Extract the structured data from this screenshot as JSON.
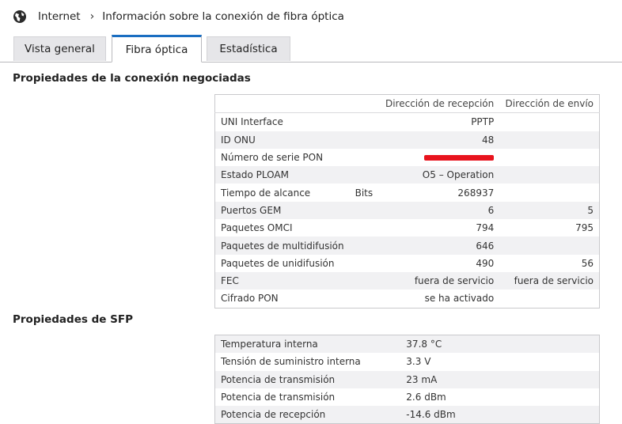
{
  "breadcrumb": {
    "root": "Internet",
    "current": "Información sobre la conexión de fibra óptica"
  },
  "tabs": [
    "Vista general",
    "Fibra óptica",
    "Estadística"
  ],
  "negotiated": {
    "title": "Propiedades de la conexión negociadas",
    "headers": {
      "rx": "Dirección de recepción",
      "tx": "Dirección de envío"
    },
    "rows": [
      {
        "label": "UNI Interface",
        "unit": "",
        "rx": "PPTP",
        "tx": ""
      },
      {
        "label": "ID ONU",
        "unit": "",
        "rx": "48",
        "tx": ""
      },
      {
        "label": "Número de serie PON",
        "unit": "",
        "rx": "",
        "tx": ""
      },
      {
        "label": "Estado PLOAM",
        "unit": "",
        "rx": "O5 – Operation",
        "tx": ""
      },
      {
        "label": "Tiempo de alcance",
        "unit": "Bits",
        "rx": "268937",
        "tx": ""
      },
      {
        "label": "Puertos GEM",
        "unit": "",
        "rx": "6",
        "tx": "5"
      },
      {
        "label": "Paquetes OMCI",
        "unit": "",
        "rx": "794",
        "tx": "795"
      },
      {
        "label": "Paquetes de multidifusión",
        "unit": "",
        "rx": "646",
        "tx": ""
      },
      {
        "label": "Paquetes de unidifusión",
        "unit": "",
        "rx": "490",
        "tx": "56"
      },
      {
        "label": "FEC",
        "unit": "",
        "rx": "fuera de servicio",
        "tx": "fuera de servicio"
      },
      {
        "label": "Cifrado PON",
        "unit": "",
        "rx": "se ha activado",
        "tx": ""
      }
    ]
  },
  "sfp": {
    "title": "Propiedades de SFP",
    "rows": [
      {
        "label": "Temperatura interna",
        "value": "37.8 °C"
      },
      {
        "label": "Tensión de suministro interna",
        "value": "3.3 V"
      },
      {
        "label": "Potencia de transmisión",
        "value": "23 mA"
      },
      {
        "label": "Potencia de transmisión",
        "value": "2.6 dBm"
      },
      {
        "label": "Potencia de recepción",
        "value": "-14.6 dBm"
      }
    ]
  },
  "colors": {
    "accent": "#1a6ec1",
    "redaction": "#e8131d",
    "row_alt": "#f1f1f3"
  },
  "icons": {
    "breadcrumb": "globe-icon",
    "separator": "chevron-right-icon"
  }
}
